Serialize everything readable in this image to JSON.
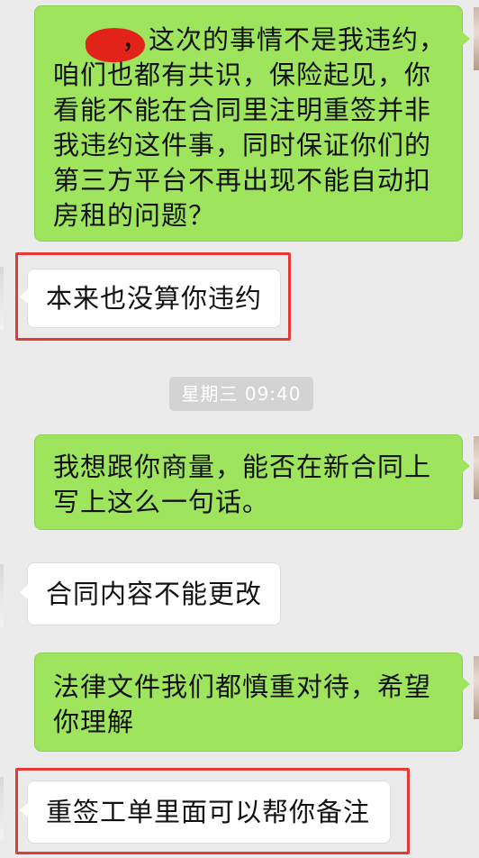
{
  "messages": [
    {
      "id": "m1",
      "from": "me",
      "text": "，这次的事情不是我违约，咱们也都有共识，保险起见，你看能不能在合同里注明重签并非我违约这件事，同时保证你们的第三方平台不再出现不能自动扣房租的问题？",
      "lines": [
        "，这次的事情不是我违约，",
        "咱们也都有共识，保险起见，你",
        "看能不能在合同里注明重签并非",
        "我违约这件事，同时保证你们的",
        "第三方平台不再出现不能自动扣",
        "房租的问题？"
      ]
    },
    {
      "id": "m2",
      "from": "other",
      "text": "本来也没算你违约",
      "highlighted": true
    },
    {
      "id": "ts1",
      "type": "timestamp",
      "text": "星期三 09:40"
    },
    {
      "id": "m3",
      "from": "me",
      "lines": [
        "我想跟你商量，能否在新合同上",
        "写上这么一句话。"
      ]
    },
    {
      "id": "m4",
      "from": "other",
      "text": "合同内容不能更改"
    },
    {
      "id": "m5",
      "from": "me",
      "lines": [
        "法律文件我们都慎重对待，希望",
        "你理解"
      ]
    },
    {
      "id": "m6",
      "from": "other",
      "text": "重签工单里面可以帮你备注",
      "highlighted": true
    }
  ],
  "colors": {
    "sent_bubble": "#9ee55d",
    "received_bubble": "#ffffff",
    "background": "#ebebeb",
    "highlight_box": "#e43b35",
    "redaction": "#e2231a"
  }
}
